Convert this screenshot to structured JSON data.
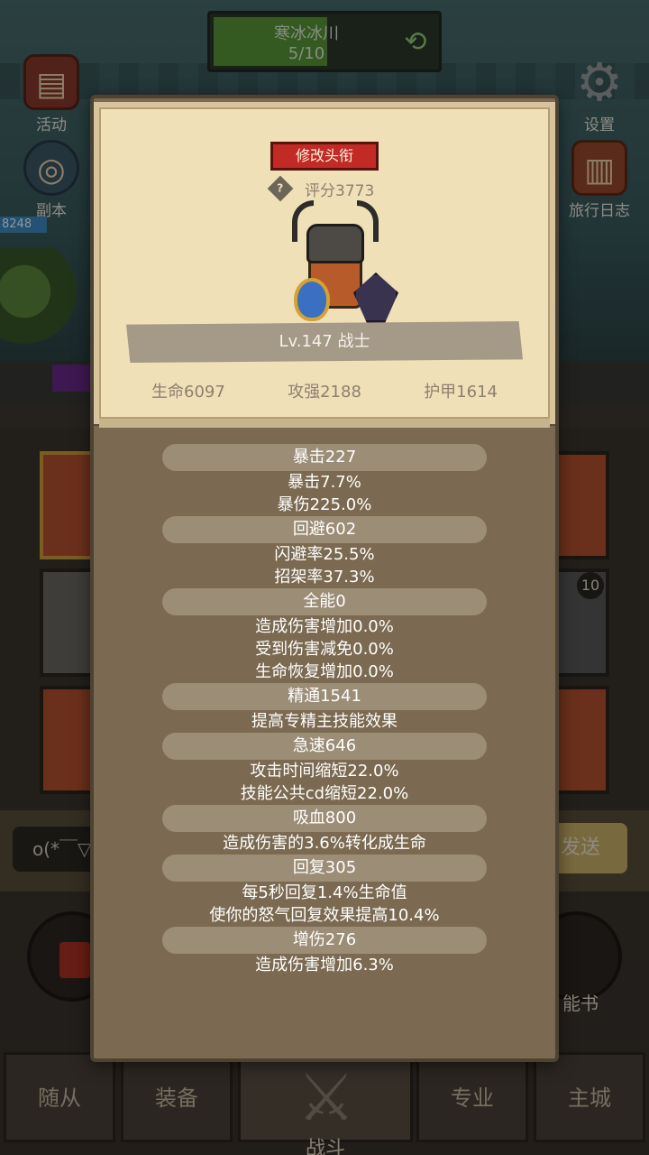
{
  "background": {
    "stage": {
      "name": "寒冰冰川",
      "progress_text": "5/10"
    },
    "side_buttons": {
      "activity": "活动",
      "dungeon": "副本",
      "settings": "设置",
      "journal": "旅行日志"
    },
    "level_tag": "8248",
    "slot_badge": "10",
    "chat": {
      "input_text": "o(*￣▽",
      "send_label": "发送"
    },
    "skill_book_label": "能书",
    "nav": {
      "follower": "随从",
      "equipment": "装备",
      "battle": "战斗",
      "profession": "专业",
      "main_city": "主城"
    }
  },
  "popup": {
    "change_title_button": "修改头衔",
    "rating_icon": "?",
    "rating": "评分3773",
    "level_class": "Lv.147 战士",
    "stats": {
      "hp": "生命6097",
      "attack": "攻强2188",
      "armor": "护甲1614"
    },
    "attributes": [
      {
        "header": "暴击227",
        "lines": [
          "暴击7.7%",
          "暴伤225.0%"
        ]
      },
      {
        "header": "回避602",
        "lines": [
          "闪避率25.5%",
          "招架率37.3%"
        ]
      },
      {
        "header": "全能0",
        "lines": [
          "造成伤害增加0.0%",
          "受到伤害减免0.0%",
          "生命恢复增加0.0%"
        ]
      },
      {
        "header": "精通1541",
        "lines": [
          "提高专精主技能效果"
        ]
      },
      {
        "header": "急速646",
        "lines": [
          "攻击时间缩短22.0%",
          "技能公共cd缩短22.0%"
        ]
      },
      {
        "header": "吸血800",
        "lines": [
          "造成伤害的3.6%转化成生命"
        ]
      },
      {
        "header": "回复305",
        "lines": [
          "每5秒回复1.4%生命值",
          "使你的怒气回复效果提高10.4%"
        ]
      },
      {
        "header": "增伤276",
        "lines": [
          "造成伤害增加6.3%"
        ]
      }
    ]
  },
  "colors": {
    "popup_bg": "#7b6a51",
    "card_bg": "#f0e0b8",
    "title_button": "#c22a25",
    "attr_header_bg": "#9c8d77"
  }
}
